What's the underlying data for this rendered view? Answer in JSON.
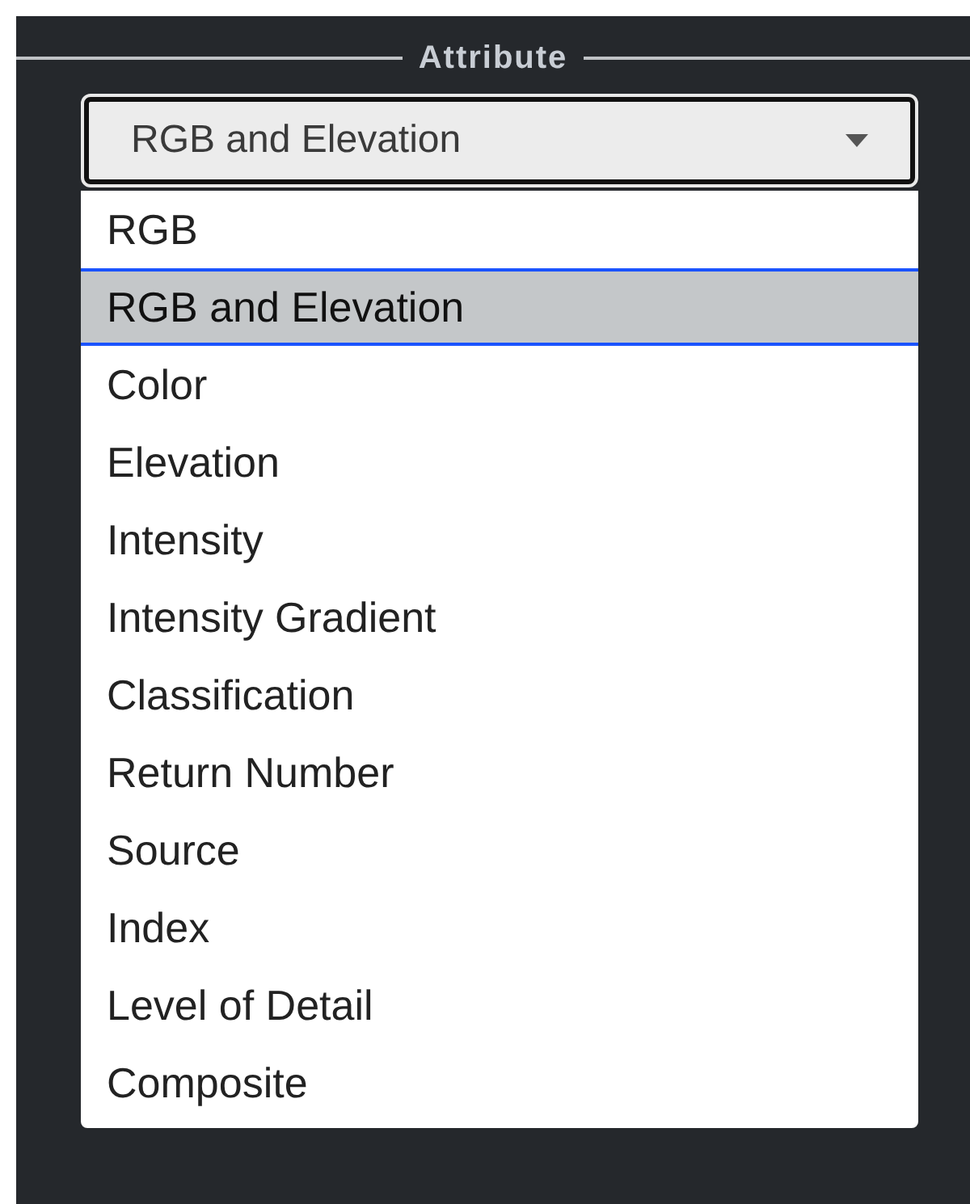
{
  "section": {
    "title": "Attribute"
  },
  "select": {
    "value": "RGB and Elevation",
    "expanded": true
  },
  "options": [
    {
      "label": "RGB",
      "selected": false
    },
    {
      "label": "RGB and Elevation",
      "selected": true
    },
    {
      "label": "Color",
      "selected": false
    },
    {
      "label": "Elevation",
      "selected": false
    },
    {
      "label": "Intensity",
      "selected": false
    },
    {
      "label": "Intensity Gradient",
      "selected": false
    },
    {
      "label": "Classification",
      "selected": false
    },
    {
      "label": "Return Number",
      "selected": false
    },
    {
      "label": "Source",
      "selected": false
    },
    {
      "label": "Index",
      "selected": false
    },
    {
      "label": "Level of Detail",
      "selected": false
    },
    {
      "label": "Composite",
      "selected": false
    }
  ]
}
